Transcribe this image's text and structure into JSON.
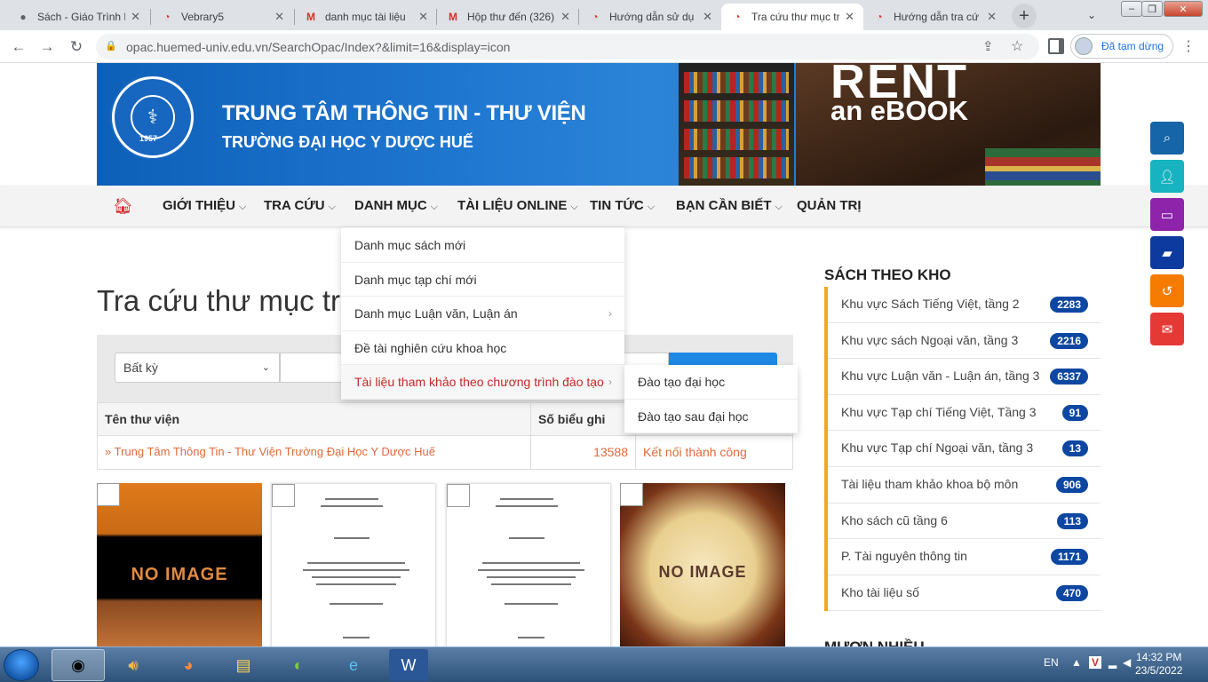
{
  "browser": {
    "tabs": [
      {
        "title": "Sách - Giáo Trình E",
        "favicon": "globe-icon"
      },
      {
        "title": "Vebrary5",
        "favicon": "vebrary-icon"
      },
      {
        "title": "danh mục tài liệu",
        "favicon": "gmail-icon"
      },
      {
        "title": "Hộp thư đến (326)",
        "favicon": "gmail-icon"
      },
      {
        "title": "Hướng dẫn sử dụ",
        "favicon": "vebrary-icon"
      },
      {
        "title": "Tra cứu thư mục tr",
        "favicon": "vebrary-icon",
        "active": true
      },
      {
        "title": "Hướng dẫn tra cứ",
        "favicon": "vebrary-icon"
      }
    ],
    "url": "opac.huemed-univ.edu.vn/SearchOpac/Index?&limit=16&display=icon",
    "profile_status": "Đã tạm dừng"
  },
  "header": {
    "title": "TRUNG TÂM THÔNG TIN - THƯ VIỆN",
    "subtitle": "TRƯỜNG ĐẠI HỌC Y DƯỢC HUẾ",
    "logo_year": "1957",
    "banner_line1": "RENT",
    "banner_line2": "an eBOOK"
  },
  "nav": {
    "items": [
      "GIỚI THIỆU",
      "TRA CỨU",
      "DANH MỤC",
      "TÀI LIỆU ONLINE",
      "TIN TỨC",
      "BẠN CẦN BIẾT",
      "QUẢN TRỊ"
    ]
  },
  "dropdown": {
    "items": [
      "Danh mục sách mới",
      "Danh mục tạp chí mới",
      "Danh mục Luận văn, Luận án",
      "Đề tài nghiên cứu khoa học",
      "Tài liệu tham khảo theo chương trình đào tạo"
    ],
    "submenu": [
      "Đào tạo đại học",
      "Đào tạo sau đại học"
    ]
  },
  "main": {
    "heading": "Tra cứu thư mục trự",
    "search_field": "Bất kỳ",
    "table": {
      "headers": [
        "Tên thư viện",
        "Số biểu ghi",
        ""
      ],
      "rows": [
        [
          "» Trung Tâm Thông Tin - Thư Viện Trường Đại Học Y Dược Huế",
          "13588",
          "Kết nối thành công"
        ]
      ]
    },
    "no_image_label": "NO IMAGE"
  },
  "sidebar": {
    "title": "SÁCH THEO KHO",
    "items": [
      {
        "label": "Khu vực Sách Tiếng Việt, tầng 2",
        "count": "2283"
      },
      {
        "label": "Khu vực sách Ngoại văn, tầng 3",
        "count": "2216"
      },
      {
        "label": "Khu vực Luận văn - Luận án, tầng 3",
        "count": "6337"
      },
      {
        "label": "Khu vực Tạp chí Tiếng Việt, Tầng 3",
        "count": "91"
      },
      {
        "label": "Khu vực Tạp chí Ngoại văn, tầng 3",
        "count": "13"
      },
      {
        "label": "Tài liệu tham khảo khoa bộ môn",
        "count": "906"
      },
      {
        "label": "Kho sách cũ tầng 6",
        "count": "113"
      },
      {
        "label": "P. Tài nguyên thông tin",
        "count": "1171"
      },
      {
        "label": "Kho tài liệu số",
        "count": "470"
      }
    ],
    "next_title": "MƯỢN NHIỀU"
  },
  "taskbar": {
    "lang": "EN",
    "time": "14:32 PM",
    "date": "23/5/2022"
  },
  "colors": {
    "brand_blue": "#1a6bc2",
    "nav_red": "#c62828",
    "badge_blue": "#0d47a1",
    "accent_orange": "#f5a623"
  }
}
